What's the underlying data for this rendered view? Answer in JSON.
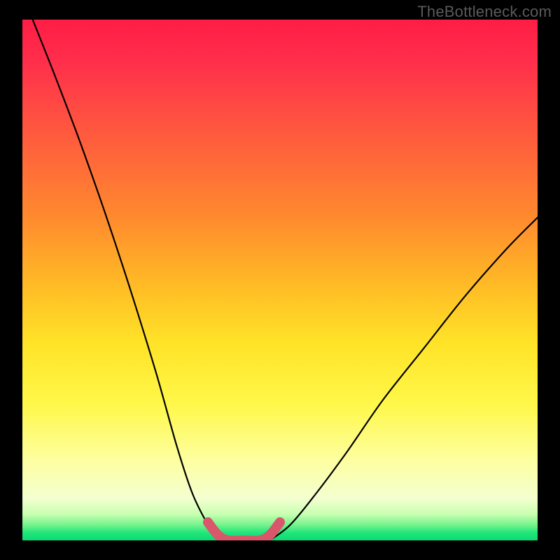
{
  "watermark": "TheBottleneck.com",
  "chart_data": {
    "type": "line",
    "title": "",
    "xlabel": "",
    "ylabel": "",
    "xlim": [
      0,
      100
    ],
    "ylim": [
      0,
      100
    ],
    "grid": false,
    "legend": false,
    "series": [
      {
        "name": "curve-left-black",
        "x": [
          2,
          6,
          11,
          16,
          21,
          26,
          30,
          33,
          36,
          38
        ],
        "values": [
          100,
          90,
          77,
          63,
          48,
          32,
          18,
          9,
          3,
          0
        ]
      },
      {
        "name": "curve-right-black",
        "x": [
          48,
          52,
          57,
          63,
          70,
          78,
          86,
          94,
          100
        ],
        "values": [
          0,
          3,
          9,
          17,
          27,
          37,
          47,
          56,
          62
        ]
      },
      {
        "name": "floor-red-highlight",
        "x": [
          36,
          38,
          40,
          43,
          46,
          48,
          50
        ],
        "values": [
          3.5,
          1,
          0,
          0,
          0,
          1,
          3.5
        ]
      }
    ]
  }
}
